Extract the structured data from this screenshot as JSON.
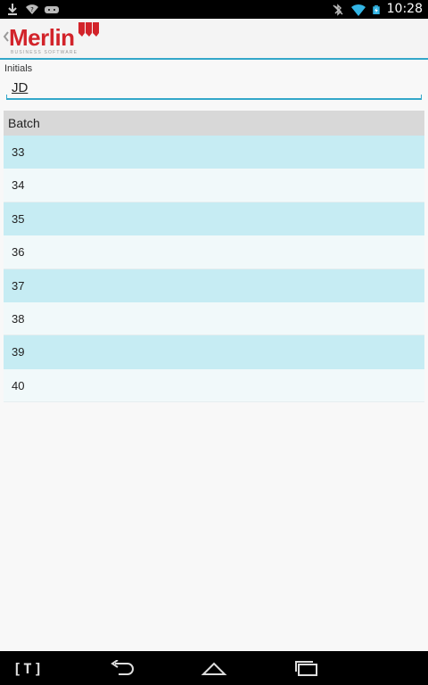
{
  "status_bar": {
    "time": "10:28",
    "left_icons": [
      "download-icon",
      "wifi-question-icon",
      "gamepad-icon"
    ],
    "right_icons": [
      "bluetooth-off-icon",
      "wifi-icon",
      "battery-charging-icon"
    ]
  },
  "action_bar": {
    "logo_text": "Merlin",
    "logo_subtitle": "BUSINESS SOFTWARE",
    "brand_color": "#d2232a",
    "accent_color": "#33a7c9"
  },
  "initials": {
    "label": "Initials",
    "value": "JD"
  },
  "batch_list": {
    "header": "Batch",
    "items": [
      "33",
      "34",
      "35",
      "36",
      "37",
      "38",
      "39",
      "40"
    ]
  },
  "nav_bar": {
    "buttons": [
      "keyboard-toggle-icon",
      "back-icon",
      "home-icon",
      "recent-apps-icon"
    ],
    "keyboard_label": "[T]"
  }
}
